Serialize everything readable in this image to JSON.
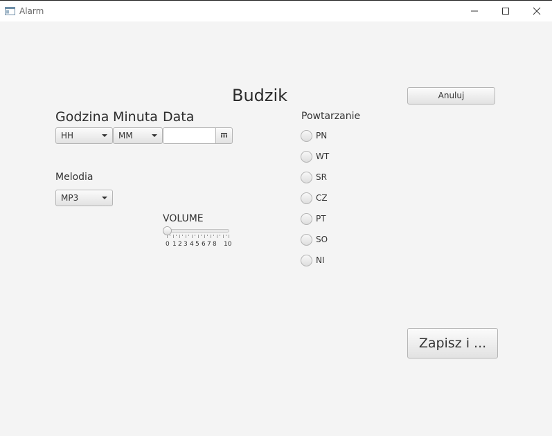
{
  "window": {
    "title": "Alarm",
    "icon": "app-window-icon"
  },
  "header": {
    "title": "Budzik",
    "cancel_label": "Anuluj"
  },
  "time": {
    "hour_label": "Godzina",
    "hour_value": "HH",
    "minute_label": "Minuta",
    "minute_value": "MM",
    "date_label": "Data",
    "date_value": "",
    "calendar_icon": "calendar-icon"
  },
  "melody": {
    "label": "Melodia",
    "value": "MP3"
  },
  "volume": {
    "label": "VOLUME",
    "value": 0,
    "min": 0,
    "max": 10,
    "tick_labels": [
      "0",
      "1",
      "2",
      "3",
      "4",
      "5",
      "6",
      "7",
      "8",
      "10"
    ]
  },
  "repeat": {
    "label": "Powtarzanie",
    "days": [
      "PN",
      "WT",
      "SR",
      "CZ",
      "PT",
      "SO",
      "NI"
    ]
  },
  "save_label": "Zapisz i ..."
}
